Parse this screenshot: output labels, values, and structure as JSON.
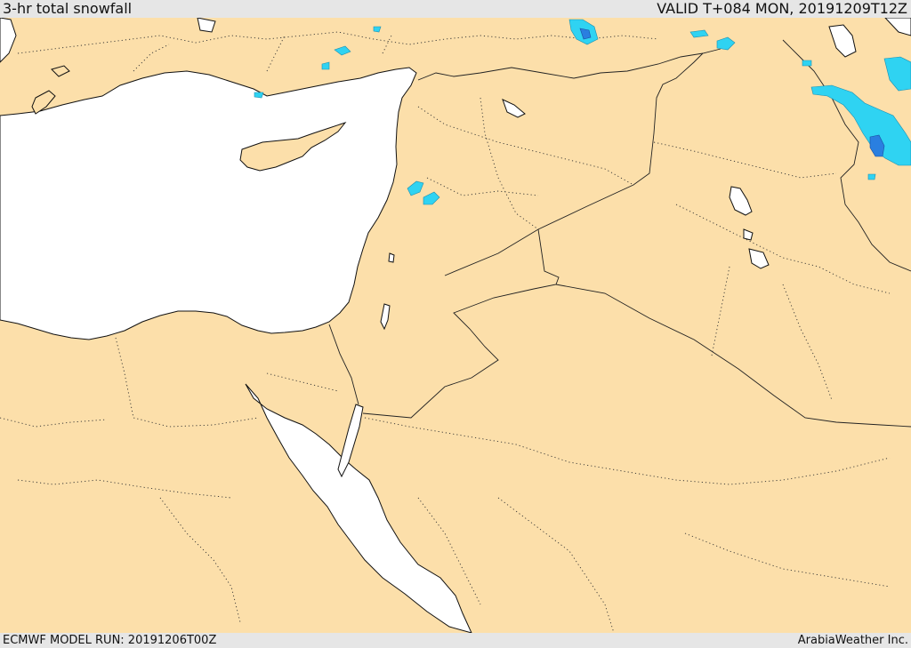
{
  "header": {
    "product_title": "3-hr total snowfall",
    "valid_label": "VALID T+084 MON, 20191209T12Z"
  },
  "footer": {
    "model_run": "ECMWF MODEL RUN: 20191206T00Z",
    "credit": "ArabiaWeather Inc."
  },
  "map": {
    "colors": {
      "land": "#fcdfaa",
      "water": "#ffffff",
      "snow_light": "#2fd3f2",
      "snow_heavy": "#2a7fe0"
    }
  }
}
